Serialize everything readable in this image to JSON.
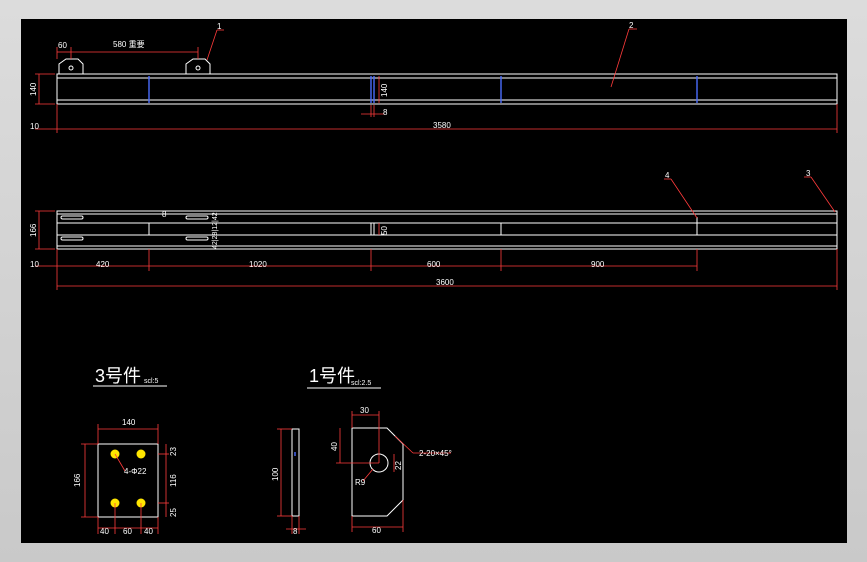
{
  "drawing": {
    "top_view": {
      "callouts": [
        "1",
        "2"
      ],
      "dims": {
        "left_offset": "60",
        "bracket_spacing": "580 重要",
        "height_left": "140",
        "height_mid": "140",
        "plate_thickness": "8",
        "left_margin": "10",
        "total_length": "3580"
      }
    },
    "front_view": {
      "callouts": [
        "4",
        "3"
      ],
      "dims": {
        "height_left": "166",
        "height_mid": "50",
        "small_gap": "8",
        "stack_dims": "42|28|12|42",
        "left_margin": "10",
        "segments": [
          "420",
          "1020",
          "600",
          "900"
        ],
        "total_length": "3600"
      }
    },
    "part3": {
      "title": "3号件",
      "scale": "scl:5",
      "dims": {
        "width": "140",
        "height": "166",
        "top_edge": "23",
        "inner_height": "116",
        "bottom_edge": "25",
        "holes": "4-Φ22",
        "bottom": [
          "40",
          "60",
          "40"
        ]
      }
    },
    "part1": {
      "title": "1号件",
      "scale": "scl:2.5",
      "dims": {
        "side_height": "100",
        "side_thickness": "8",
        "top": "30",
        "left": "40",
        "chamfer": "2-20×45°",
        "hole_dia": "22",
        "radius": "R9",
        "bottom_width": "60"
      }
    }
  }
}
